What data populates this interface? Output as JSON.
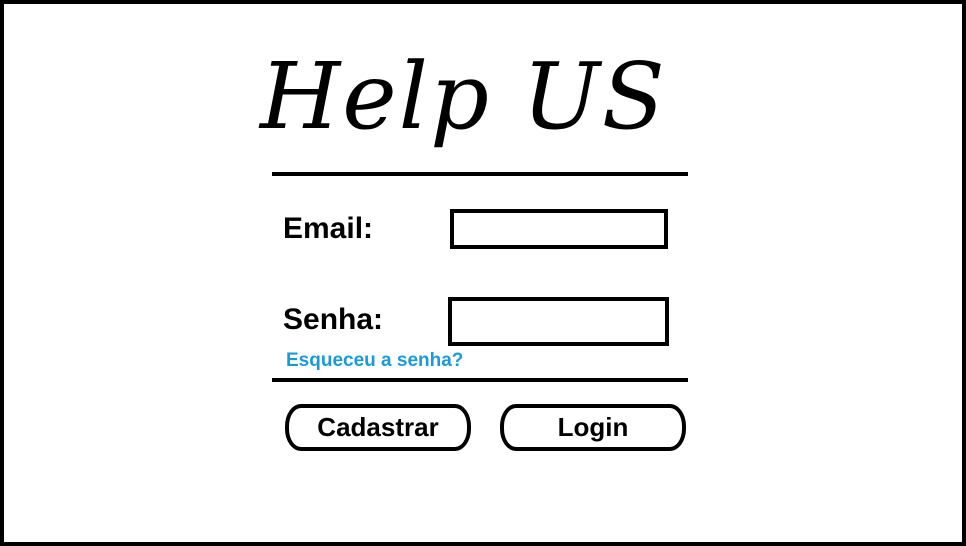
{
  "app": {
    "title": "Help US"
  },
  "form": {
    "email_label": "Email:",
    "email_value": "",
    "password_label": "Senha:",
    "password_value": "",
    "forgot_password_link": "Esqueceu a senha?"
  },
  "actions": {
    "register_label": "Cadastrar",
    "login_label": "Login"
  },
  "colors": {
    "link": "#1a9bd7",
    "border": "#000000",
    "background": "#ffffff"
  }
}
